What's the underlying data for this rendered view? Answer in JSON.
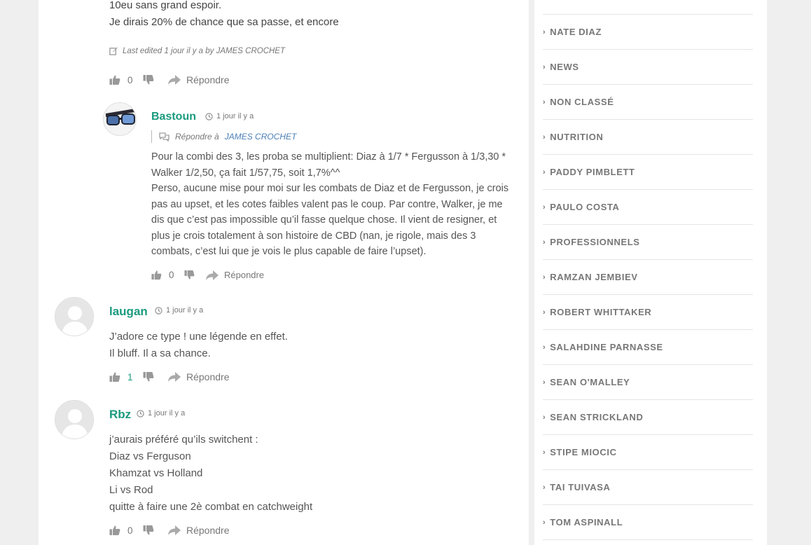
{
  "previous_comment": {
    "lines": [
      "10eu sans grand espoir.",
      "Je dirais 20% de chance que sa passe, et encore"
    ],
    "edited_note": "Last edited 1 jour il y a by JAMES CROCHET",
    "likes": "0",
    "reply_label": "Répondre"
  },
  "comments": [
    {
      "author": "Bastoun",
      "time": "1 jour il y a",
      "reply_to_prefix": "Répondre à",
      "reply_to_name": "JAMES CROCHET",
      "paragraphs": [
        "Pour la combi des 3, les proba se multiplient: Diaz à 1/7 * Fergusson à 1/3,30 * Walker 1/2,50, ça fait 1/57,75, soit 1,7%^^",
        "Perso, aucune mise pour moi sur les combats de Diaz et de Fergusson, je crois pas au upset, et les cotes faibles valent pas le coup. Par contre, Walker, je me dis que c’est pas impossible qu’il fasse quelque chose. Il vient de resigner, et plus je crois totalement à son histoire de CBD (nan, je rigole, mais des 3 combats, c’est lui que je vois le plus capable de faire l’upset)."
      ],
      "likes": "0",
      "reply_label": "Répondre"
    },
    {
      "author": "laugan",
      "time": "1 jour il y a",
      "lines": [
        "J’adore ce type ! une légende en effet.",
        "Il bluff. Il a sa chance."
      ],
      "likes": "1",
      "reply_label": "Répondre"
    },
    {
      "author": "Rbz",
      "time": "1 jour il y a",
      "lines": [
        "j’aurais préféré qu’ils switchent :",
        "Diaz vs Ferguson",
        "Khamzat vs Holland",
        "Li vs Rod",
        "quitte à faire une 2è combat en catchweight"
      ],
      "likes": "0",
      "reply_label": "Répondre"
    }
  ],
  "sidebar": {
    "categories": [
      "NATE DIAZ",
      "NEWS",
      "NON CLASSÉ",
      "NUTRITION",
      "PADDY PIMBLETT",
      "PAULO COSTA",
      "PROFESSIONNELS",
      "RAMZAN JEMBIEV",
      "ROBERT WHITTAKER",
      "SALAHDINE PARNASSE",
      "SEAN O'MALLEY",
      "SEAN STRICKLAND",
      "STIPE MIOCIC",
      "TAI TUIVASA",
      "TOM ASPINALL"
    ]
  },
  "colors": {
    "author": "#1a9a7e",
    "link": "#4a7fb5",
    "page_bg": "#efefef"
  }
}
